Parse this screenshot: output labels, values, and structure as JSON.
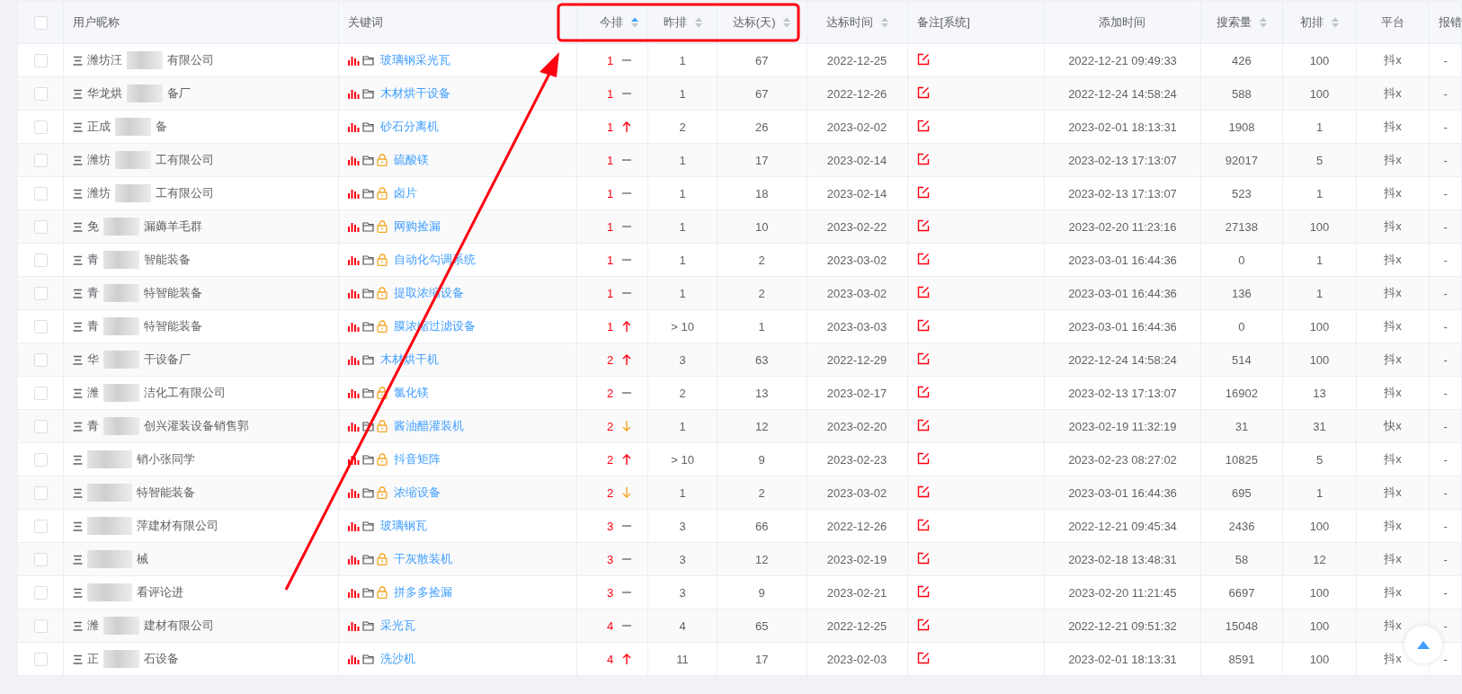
{
  "table": {
    "all_checked": false,
    "columns": [
      {
        "label": "用户昵称",
        "sortable": false
      },
      {
        "label": "关键词",
        "sortable": false
      },
      {
        "label": "今排",
        "sortable": true,
        "sorted_ascending": true
      },
      {
        "label": "昨排",
        "sortable": true,
        "sorted_ascending": false
      },
      {
        "label": "达标(天)",
        "sortable": true,
        "sorted_ascending": false
      },
      {
        "label": "达标时间",
        "sortable": true,
        "sorted_ascending": false
      },
      {
        "label": "备注[系统]",
        "sortable": false
      },
      {
        "label": "添加时间",
        "sortable": false
      },
      {
        "label": "搜索量",
        "sortable": true,
        "sorted_ascending": false
      },
      {
        "label": "初排",
        "sortable": true,
        "sorted_ascending": false
      },
      {
        "label": "平台",
        "sortable": false
      },
      {
        "label": "报错",
        "sortable": false
      }
    ],
    "rows": [
      {
        "checked": false,
        "name_start": "潍坊汪",
        "name_end": "有限公司",
        "keyword": "玻璃钢采光瓦",
        "locked": false,
        "rank": "1",
        "rising": false,
        "falling": false,
        "yesterday": "1",
        "days": "67",
        "reach_date": "2022-12-25",
        "added": "2022-12-21 09:49:33",
        "searches": "426",
        "initial": "100",
        "platform": "抖x",
        "error": "-"
      },
      {
        "checked": false,
        "name_start": "华龙烘",
        "name_end": "备厂",
        "keyword": "木材烘干设备",
        "locked": false,
        "rank": "1",
        "rising": false,
        "falling": false,
        "yesterday": "1",
        "days": "67",
        "reach_date": "2022-12-26",
        "added": "2022-12-24 14:58:24",
        "searches": "588",
        "initial": "100",
        "platform": "抖x",
        "error": "-"
      },
      {
        "checked": false,
        "name_start": "正成",
        "name_end": "备",
        "keyword": "砂石分离机",
        "locked": false,
        "rank": "1",
        "rising": true,
        "falling": false,
        "yesterday": "2",
        "days": "26",
        "reach_date": "2023-02-02",
        "added": "2023-02-01 18:13:31",
        "searches": "1908",
        "initial": "1",
        "platform": "抖x",
        "error": "-"
      },
      {
        "checked": false,
        "name_start": "潍坊",
        "name_end": "工有限公司",
        "keyword": "硫酸镁",
        "locked": true,
        "rank": "1",
        "rising": false,
        "falling": false,
        "yesterday": "1",
        "days": "17",
        "reach_date": "2023-02-14",
        "added": "2023-02-13 17:13:07",
        "searches": "92017",
        "initial": "5",
        "platform": "抖x",
        "error": "-"
      },
      {
        "checked": false,
        "name_start": "潍坊",
        "name_end": "工有限公司",
        "keyword": "卤片",
        "locked": true,
        "rank": "1",
        "rising": false,
        "falling": false,
        "yesterday": "1",
        "days": "18",
        "reach_date": "2023-02-14",
        "added": "2023-02-13 17:13:07",
        "searches": "523",
        "initial": "1",
        "platform": "抖x",
        "error": "-"
      },
      {
        "checked": false,
        "name_start": "免",
        "name_end": "漏薅羊毛群",
        "keyword": "网购捡漏",
        "locked": true,
        "rank": "1",
        "rising": false,
        "falling": false,
        "yesterday": "1",
        "days": "10",
        "reach_date": "2023-02-22",
        "added": "2023-02-20 11:23:16",
        "searches": "27138",
        "initial": "100",
        "platform": "抖x",
        "error": "-"
      },
      {
        "checked": false,
        "name_start": "青",
        "name_end": "智能装备",
        "keyword": "自动化勾调系统",
        "locked": true,
        "rank": "1",
        "rising": false,
        "falling": false,
        "yesterday": "1",
        "days": "2",
        "reach_date": "2023-03-02",
        "added": "2023-03-01 16:44:36",
        "searches": "0",
        "initial": "1",
        "platform": "抖x",
        "error": "-"
      },
      {
        "checked": false,
        "name_start": "青",
        "name_end": "特智能装备",
        "keyword": "提取浓缩设备",
        "locked": true,
        "rank": "1",
        "rising": false,
        "falling": false,
        "yesterday": "1",
        "days": "2",
        "reach_date": "2023-03-02",
        "added": "2023-03-01 16:44:36",
        "searches": "136",
        "initial": "1",
        "platform": "抖x",
        "error": "-"
      },
      {
        "checked": false,
        "name_start": "青",
        "name_end": "特智能装备",
        "keyword": "膜浓缩过滤设备",
        "locked": true,
        "rank": "1",
        "rising": true,
        "falling": false,
        "yesterday": "> 10",
        "days": "1",
        "reach_date": "2023-03-03",
        "added": "2023-03-01 16:44:36",
        "searches": "0",
        "initial": "100",
        "platform": "抖x",
        "error": "-"
      },
      {
        "checked": false,
        "name_start": "华",
        "name_end": "干设备厂",
        "keyword": "木材烘干机",
        "locked": false,
        "rank": "2",
        "rising": true,
        "falling": false,
        "yesterday": "3",
        "days": "63",
        "reach_date": "2022-12-29",
        "added": "2022-12-24 14:58:24",
        "searches": "514",
        "initial": "100",
        "platform": "抖x",
        "error": "-"
      },
      {
        "checked": false,
        "name_start": "潍",
        "name_end": "洁化工有限公司",
        "keyword": "氯化镁",
        "locked": true,
        "rank": "2",
        "rising": false,
        "falling": false,
        "yesterday": "2",
        "days": "13",
        "reach_date": "2023-02-17",
        "added": "2023-02-13 17:13:07",
        "searches": "16902",
        "initial": "13",
        "platform": "抖x",
        "error": "-"
      },
      {
        "checked": false,
        "name_start": "青",
        "name_end": "创兴灌装设备销售郭",
        "keyword": "酱油醋灌装机",
        "locked": true,
        "rank": "2",
        "rising": false,
        "falling": true,
        "yesterday": "1",
        "days": "12",
        "reach_date": "2023-02-20",
        "added": "2023-02-19 11:32:19",
        "searches": "31",
        "initial": "31",
        "platform": "快x",
        "error": "-"
      },
      {
        "checked": false,
        "name_end": "销小张同学",
        "keyword": "抖音矩阵",
        "locked": true,
        "rank": "2",
        "rising": true,
        "falling": false,
        "yesterday": "> 10",
        "days": "9",
        "reach_date": "2023-02-23",
        "added": "2023-02-23 08:27:02",
        "searches": "10825",
        "initial": "5",
        "platform": "抖x",
        "error": "-"
      },
      {
        "checked": false,
        "name_end": "特智能装备",
        "keyword": "浓缩设备",
        "locked": true,
        "rank": "2",
        "rising": false,
        "falling": true,
        "yesterday": "1",
        "days": "2",
        "reach_date": "2023-03-02",
        "added": "2023-03-01 16:44:36",
        "searches": "695",
        "initial": "1",
        "platform": "抖x",
        "error": "-"
      },
      {
        "checked": false,
        "name_end": "萍建材有限公司",
        "keyword": "玻璃钢瓦",
        "locked": false,
        "rank": "3",
        "rising": false,
        "falling": false,
        "yesterday": "3",
        "days": "66",
        "reach_date": "2022-12-26",
        "added": "2022-12-21 09:45:34",
        "searches": "2436",
        "initial": "100",
        "platform": "抖x",
        "error": "-"
      },
      {
        "checked": false,
        "name_end": "械",
        "keyword": "干灰散装机",
        "locked": true,
        "rank": "3",
        "rising": false,
        "falling": false,
        "yesterday": "3",
        "days": "12",
        "reach_date": "2023-02-19",
        "added": "2023-02-18 13:48:31",
        "searches": "58",
        "initial": "12",
        "platform": "抖x",
        "error": "-"
      },
      {
        "checked": false,
        "name_end": "看评论进",
        "keyword": "拼多多捡漏",
        "locked": true,
        "rank": "3",
        "rising": false,
        "falling": false,
        "yesterday": "3",
        "days": "9",
        "reach_date": "2023-02-21",
        "added": "2023-02-20 11:21:45",
        "searches": "6697",
        "initial": "100",
        "platform": "抖x",
        "error": "-"
      },
      {
        "checked": false,
        "name_start": "潍",
        "name_end": "建材有限公司",
        "keyword": "采光瓦",
        "locked": false,
        "rank": "4",
        "rising": false,
        "falling": false,
        "yesterday": "4",
        "days": "65",
        "reach_date": "2022-12-25",
        "added": "2022-12-21 09:51:32",
        "searches": "15048",
        "initial": "100",
        "platform": "抖x",
        "error": "-"
      },
      {
        "checked": false,
        "name_start": "正",
        "name_end": "石设备",
        "keyword": "洗沙机",
        "locked": false,
        "rank": "4",
        "rising": true,
        "falling": false,
        "yesterday": "11",
        "days": "17",
        "reach_date": "2023-02-03",
        "added": "2023-02-01 18:13:31",
        "searches": "8591",
        "initial": "100",
        "platform": "抖x",
        "error": "-"
      }
    ]
  },
  "annotation": {
    "kind": "arrow-frame"
  },
  "back_to_top": {
    "kind": "button"
  }
}
